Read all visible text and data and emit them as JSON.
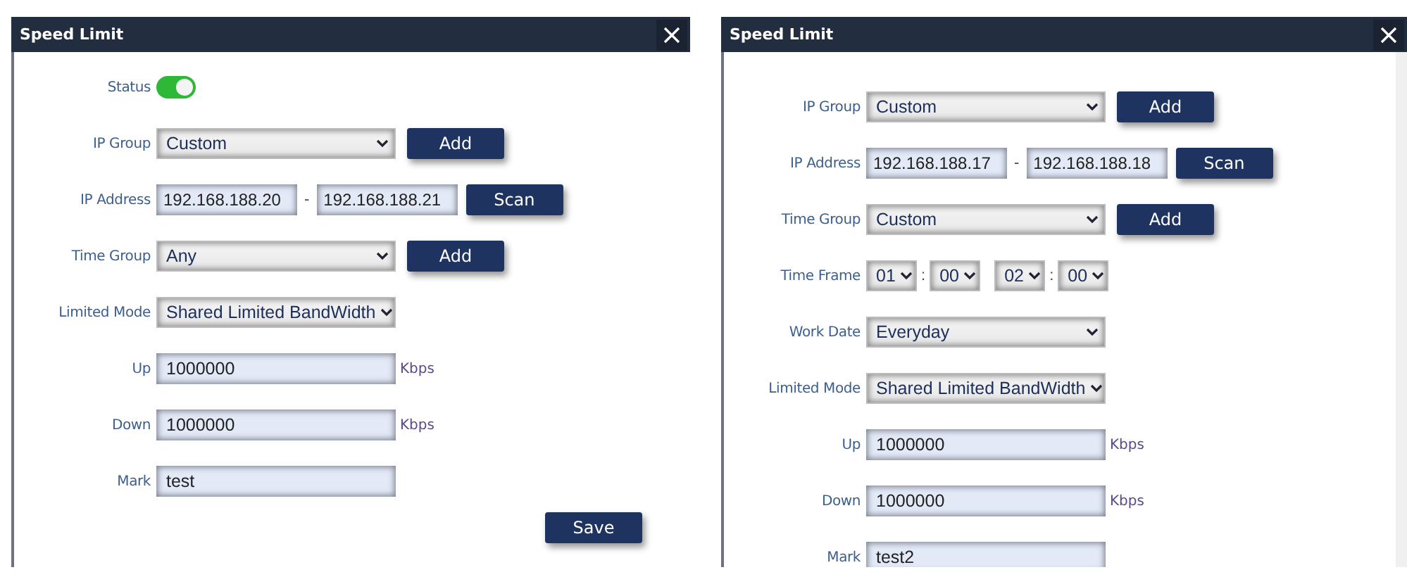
{
  "dialogs": [
    {
      "title": "Speed Limit",
      "fields": [
        {
          "kind": "toggle",
          "label": "Status",
          "on": true
        },
        {
          "kind": "select_add",
          "label": "IP Group",
          "value": "Custom",
          "button": "Add"
        },
        {
          "kind": "range",
          "label": "IP Address",
          "from": "192.168.188.20",
          "separator": "-",
          "to": "192.168.188.21",
          "button": "Scan"
        },
        {
          "kind": "select_add",
          "label": "Time Group",
          "value": "Any",
          "button": "Add"
        },
        {
          "kind": "select",
          "label": "Limited Mode",
          "value": "Shared Limited BandWidth"
        },
        {
          "kind": "number",
          "label": "Up",
          "value": "1000000",
          "unit": "Kbps"
        },
        {
          "kind": "number",
          "label": "Down",
          "value": "1000000",
          "unit": "Kbps"
        },
        {
          "kind": "text",
          "label": "Mark",
          "value": "test"
        }
      ],
      "save_button": "Save"
    },
    {
      "title": "Speed Limit",
      "fields": [
        {
          "kind": "select_add",
          "label": "IP Group",
          "value": "Custom",
          "button": "Add"
        },
        {
          "kind": "range",
          "label": "IP Address",
          "from": "192.168.188.17",
          "separator": "-",
          "to": "192.168.188.18",
          "button": "Scan"
        },
        {
          "kind": "select_add",
          "label": "Time Group",
          "value": "Custom",
          "button": "Add"
        },
        {
          "kind": "timeframe",
          "label": "Time Frame",
          "start": {
            "hour": "01",
            "minute": "00"
          },
          "end": {
            "hour": "02",
            "minute": "00"
          },
          "separator": ":"
        },
        {
          "kind": "select",
          "label": "Work Date",
          "value": "Everyday"
        },
        {
          "kind": "select",
          "label": "Limited Mode",
          "value": "Shared Limited BandWidth"
        },
        {
          "kind": "number",
          "label": "Up",
          "value": "1000000",
          "unit": "Kbps"
        },
        {
          "kind": "number",
          "label": "Down",
          "value": "1000000",
          "unit": "Kbps"
        },
        {
          "kind": "text",
          "label": "Mark",
          "value": "test2"
        }
      ]
    }
  ]
}
